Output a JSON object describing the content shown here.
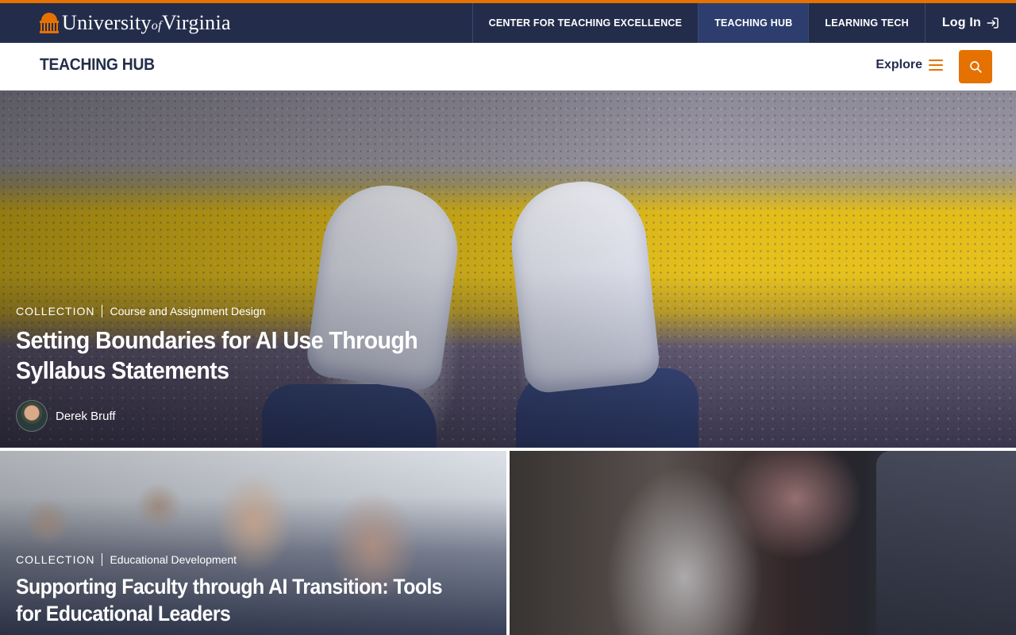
{
  "brand": {
    "logo_text_university": "University",
    "logo_text_of": "of",
    "logo_text_virginia": "Virginia",
    "accent_color": "#E57200",
    "navy_color": "#232D4B"
  },
  "top_nav": {
    "items": [
      {
        "label": "CENTER FOR TEACHING EXCELLENCE"
      },
      {
        "label": "TEACHING HUB"
      },
      {
        "label": "LEARNING TECH"
      }
    ],
    "login_label": "Log In",
    "login_icon": "login-arrow-icon"
  },
  "sub_header": {
    "site_title": "TEACHING HUB",
    "explore_label": "Explore",
    "explore_icon": "hamburger-menu-icon",
    "search_icon": "search-icon"
  },
  "hero": {
    "type": "COLLECTION",
    "category": "Course and Assignment Design",
    "title": "Setting Boundaries for AI Use Through Syllabus Statements",
    "author": "Derek Bruff"
  },
  "cards": [
    {
      "type": "COLLECTION",
      "category": "Educational Development",
      "title": "Supporting Faculty through AI Transition: Tools for Educational Leaders"
    }
  ]
}
